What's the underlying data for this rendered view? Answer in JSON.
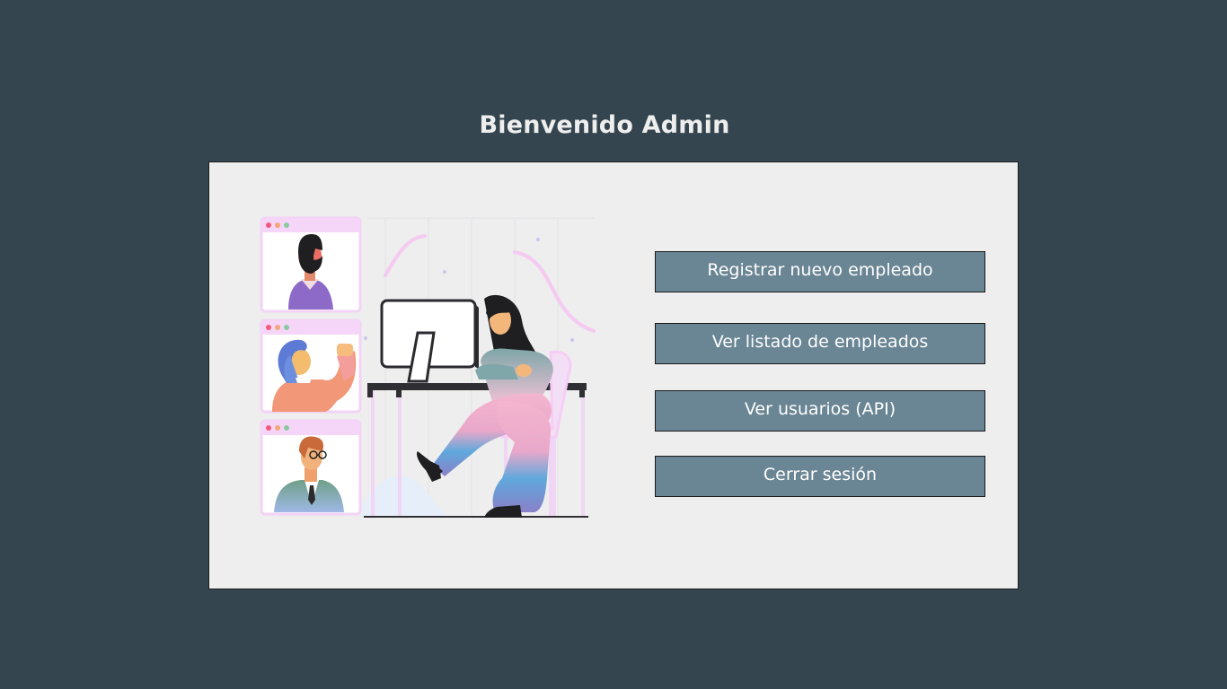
{
  "page": {
    "title": "Bienvenido Admin"
  },
  "menu": {
    "register_label": "Registrar nuevo empleado",
    "list_label": "Ver listado de empleados",
    "users_label": "Ver usuarios (API)",
    "logout_label": "Cerrar sesión"
  },
  "colors": {
    "background": "#34454f",
    "panel": "#eeeeee",
    "button": "#6a8594",
    "button_text": "#ffffff",
    "title_text": "#eeeeee"
  },
  "illustration": {
    "icon": "video-conference-illustration"
  }
}
